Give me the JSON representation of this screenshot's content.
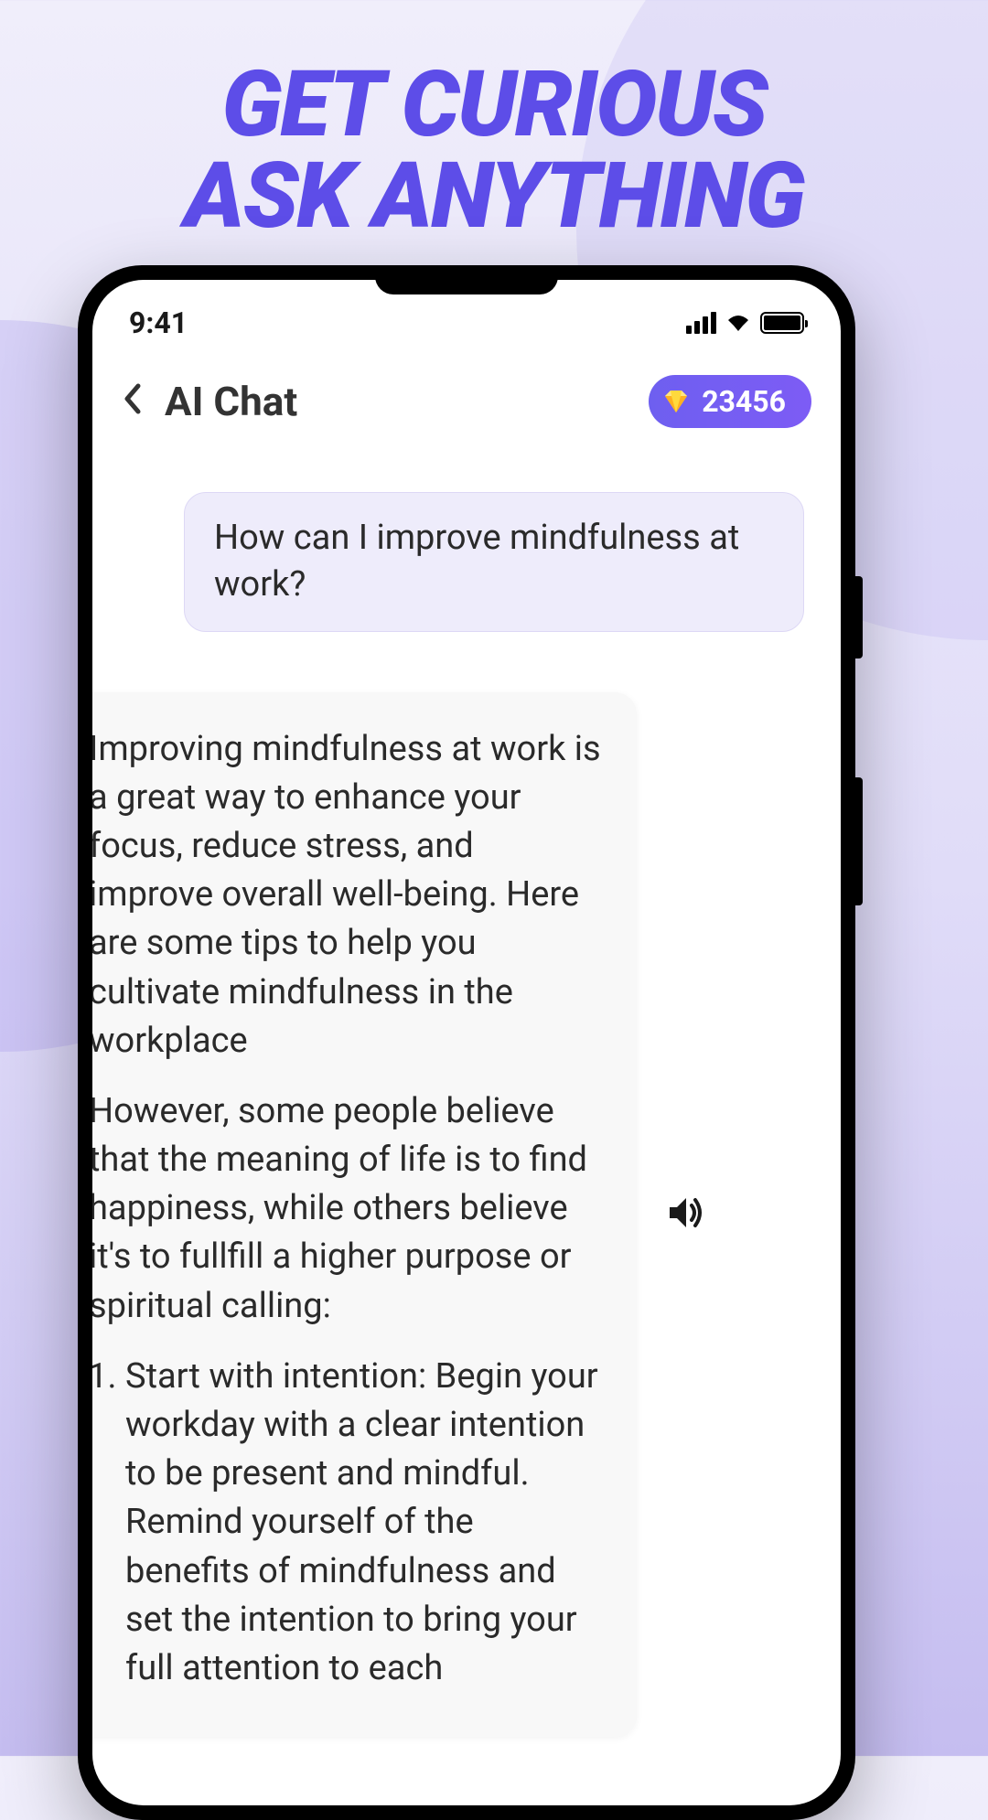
{
  "headline": {
    "line1": "GET CURIOUS",
    "line2": "ASK ANYTHING"
  },
  "statusbar": {
    "time": "9:41"
  },
  "header": {
    "title": "AI Chat",
    "credits": "23456"
  },
  "chat": {
    "user_message": "How can I improve mindfulness at work?",
    "assistant_p1": "Improving mindfulness at work is a great way to enhance your focus, reduce stress, and improve overall well-being. Here are some tips to help you cultivate mindfulness in the workplace",
    "assistant_p2": "However, some people believe that the meaning of life is to find happiness, while others believe it's to fullfill a higher purpose or spiritual calling:",
    "assistant_li1": "Start with intention: Begin your workday with a clear intention to be present and mindful. Remind yourself of the benefits of mindfulness and set the intention to bring your full attention to each"
  }
}
